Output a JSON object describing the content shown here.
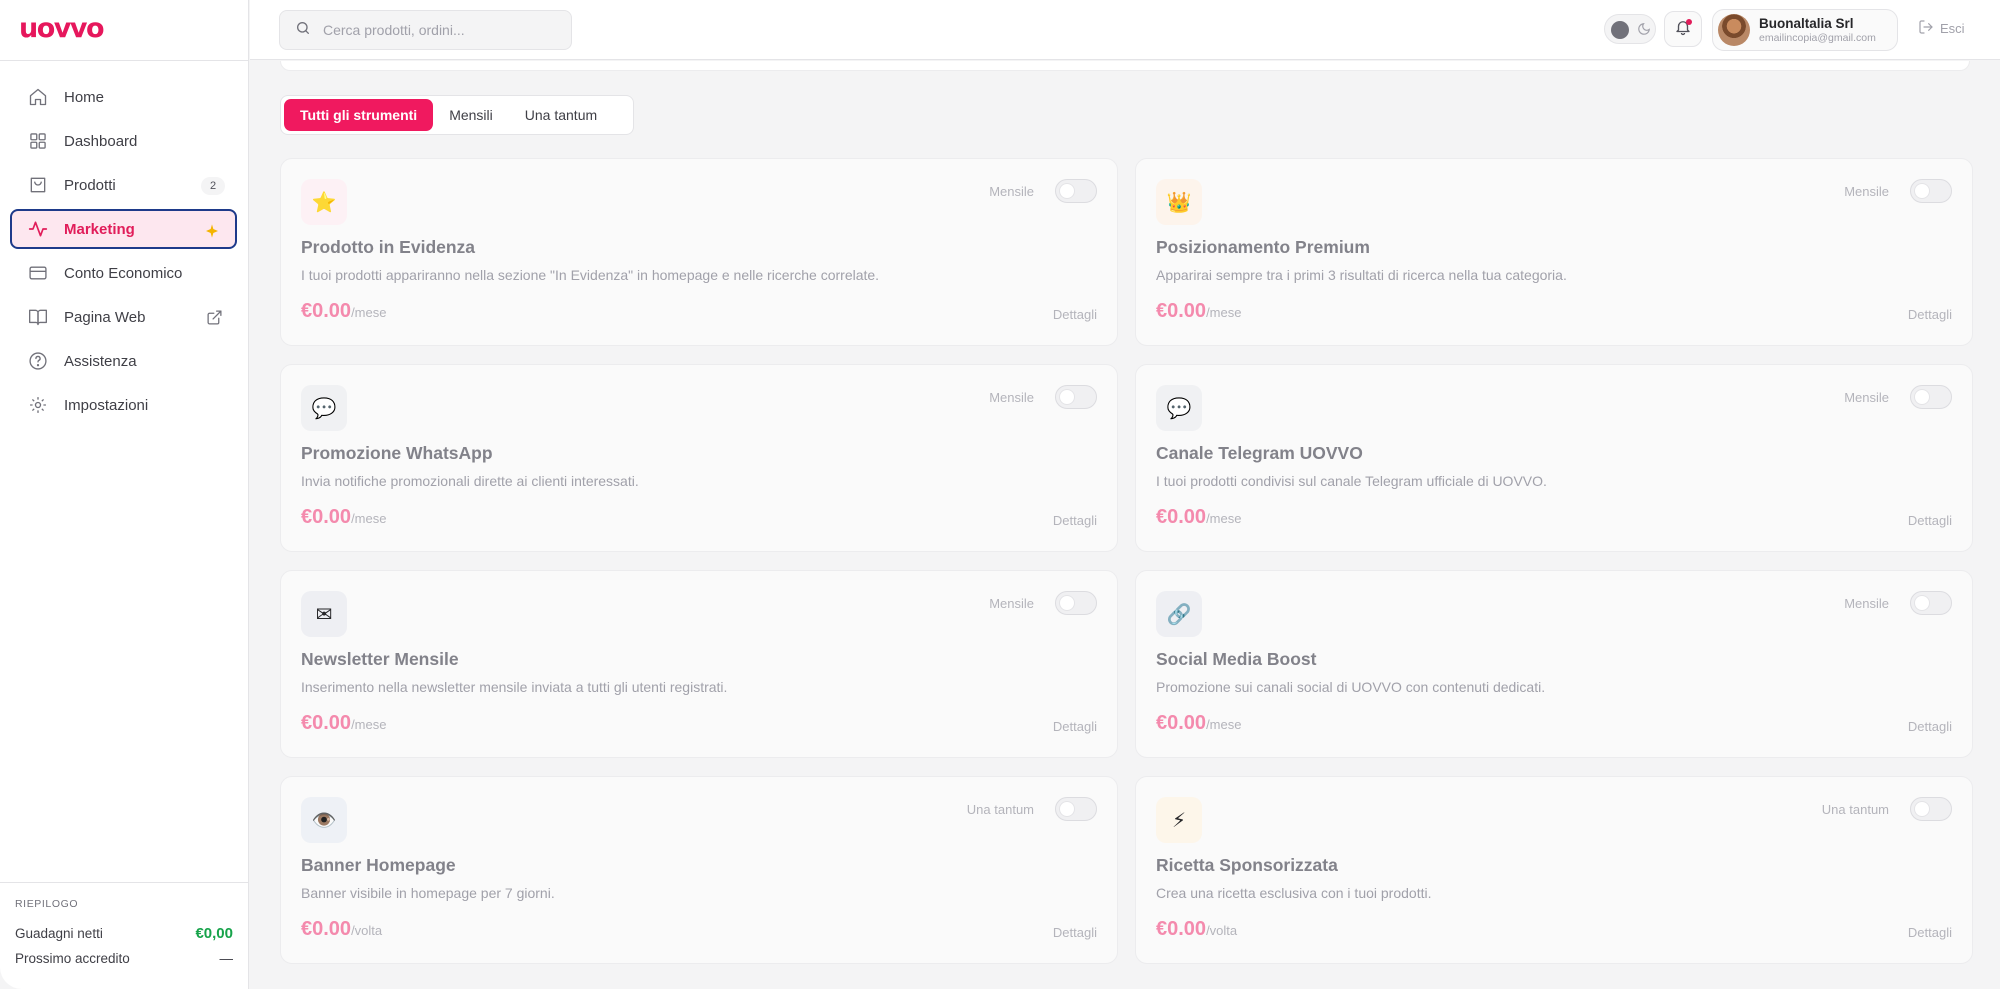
{
  "app": {
    "logo_text": "uovvo",
    "brand_color": "#e6175c"
  },
  "sidebar": {
    "items": [
      {
        "label": "Home",
        "icon": "home-icon"
      },
      {
        "label": "Dashboard",
        "icon": "grid-icon"
      },
      {
        "label": "Prodotti",
        "icon": "shopping-bag-icon",
        "badge": "2"
      },
      {
        "label": "Marketing",
        "icon": "activity-icon",
        "active": true,
        "trailing": "sparkle-icon"
      },
      {
        "label": "Conto Economico",
        "icon": "credit-card-icon"
      },
      {
        "label": "Pagina Web",
        "icon": "book-icon",
        "trailing": "external-link-icon"
      },
      {
        "label": "Assistenza",
        "icon": "help-circle-icon"
      },
      {
        "label": "Impostazioni",
        "icon": "gear-icon"
      }
    ],
    "summary": {
      "title": "RIEPILOGO",
      "net_label": "Guadagni netti",
      "net_value": "€0,00",
      "next_label": "Prossimo accredito",
      "next_value": "—"
    }
  },
  "header": {
    "search_placeholder": "Cerca prodotti, ordini...",
    "user_name": "Buonaltalia Srl",
    "user_email": "emailincopia@gmail.com",
    "logout_label": "Esci"
  },
  "tabs": [
    {
      "label": "Tutti gli strumenti",
      "active": true
    },
    {
      "label": "Mensili"
    },
    {
      "label": "Una tantum"
    }
  ],
  "tools": [
    {
      "title": "Prodotto in Evidenza",
      "desc": "I tuoi prodotti appariranno nella sezione \"In Evidenza\" in homepage e nelle ricerche correlate.",
      "price": "€0.00",
      "unit": "/mese",
      "badge": "Mensile",
      "details": "Dettagli",
      "icon": "⭐",
      "icon_name": "star-icon",
      "icon_bg": "#fdf1f5",
      "enabled": false
    },
    {
      "title": "Posizionamento Premium",
      "desc": "Apparirai sempre tra i primi 3 risultati di ricerca nella tua categoria.",
      "price": "€0.00",
      "unit": "/mese",
      "badge": "Mensile",
      "details": "Dettagli",
      "icon": "👑",
      "icon_name": "crown-icon",
      "icon_bg": "#fdf4ec",
      "enabled": false
    },
    {
      "title": "Promozione WhatsApp",
      "desc": "Invia notifiche promozionali dirette ai clienti interessati.",
      "price": "€0.00",
      "unit": "/mese",
      "badge": "Mensile",
      "details": "Dettagli",
      "icon": "💬",
      "icon_name": "chat-bubble-icon",
      "icon_bg": "#f0f1f3",
      "enabled": false
    },
    {
      "title": "Canale Telegram UOVVO",
      "desc": "I tuoi prodotti condivisi sul canale Telegram ufficiale di UOVVO.",
      "price": "€0.00",
      "unit": "/mese",
      "badge": "Mensile",
      "details": "Dettagli",
      "icon": "💬",
      "icon_name": "chat-bubble-icon",
      "icon_bg": "#f0f1f3",
      "enabled": false
    },
    {
      "title": "Newsletter Mensile",
      "desc": "Inserimento nella newsletter mensile inviata a tutti gli utenti registrati.",
      "price": "€0.00",
      "unit": "/mese",
      "badge": "Mensile",
      "details": "Dettagli",
      "icon": "✉",
      "icon_name": "envelope-icon",
      "icon_bg": "#eeeff3",
      "enabled": false
    },
    {
      "title": "Social Media Boost",
      "desc": "Promozione sui canali social di UOVVO con contenuti dedicati.",
      "price": "€0.00",
      "unit": "/mese",
      "badge": "Mensile",
      "details": "Dettagli",
      "icon": "🔗",
      "icon_name": "link-icon",
      "icon_bg": "#eeeff3",
      "enabled": false
    },
    {
      "title": "Banner Homepage",
      "desc": "Banner visibile in homepage per 7 giorni.",
      "price": "€0.00",
      "unit": "/volta",
      "badge": "Una tantum",
      "details": "Dettagli",
      "icon": "👁️",
      "icon_name": "eye-icon",
      "icon_bg": "#eef1f6",
      "enabled": false
    },
    {
      "title": "Ricetta Sponsorizzata",
      "desc": "Crea una ricetta esclusiva con i tuoi prodotti.",
      "price": "€0.00",
      "unit": "/volta",
      "badge": "Una tantum",
      "details": "Dettagli",
      "icon": "⚡",
      "icon_name": "lightning-icon",
      "icon_bg": "#fdf6ea",
      "enabled": false
    }
  ]
}
